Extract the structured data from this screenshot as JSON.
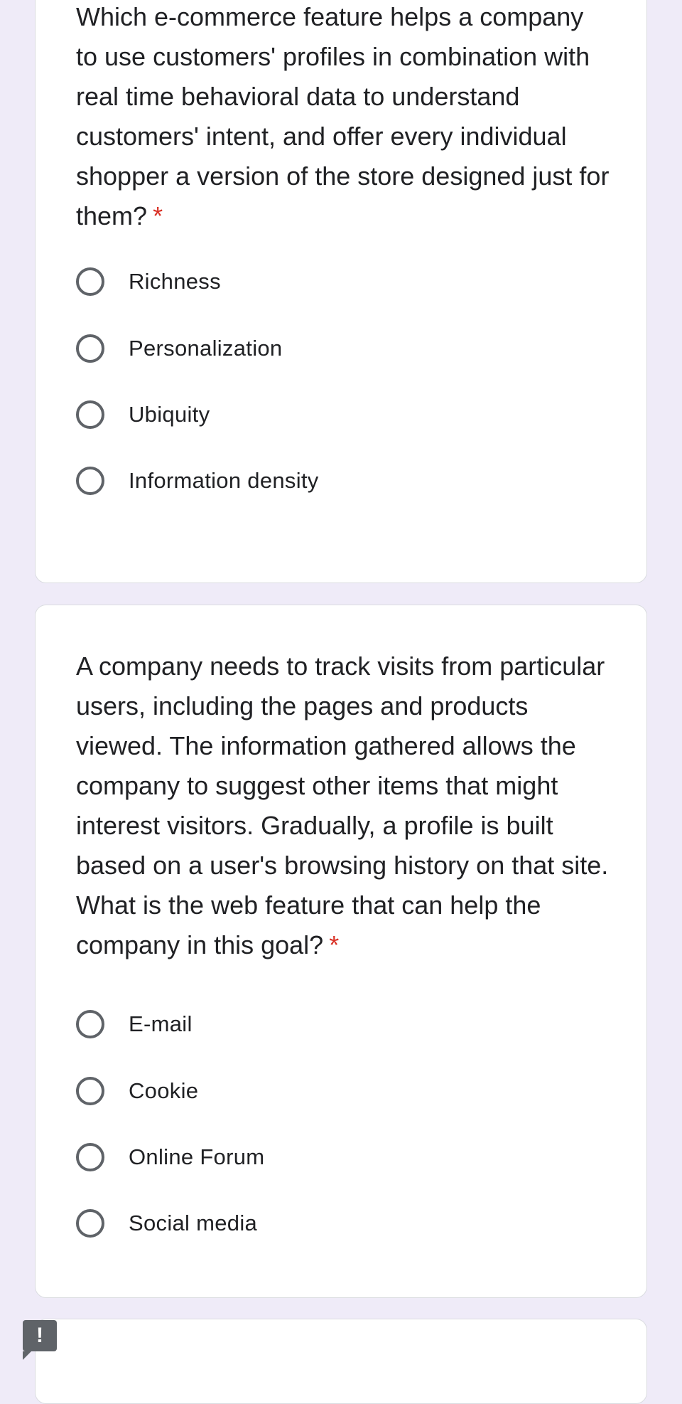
{
  "questions": [
    {
      "text": "Which e-commerce feature helps a company to use customers' profiles in combination with real time behavioral data to understand customers' intent, and offer every individual shopper a version of the store designed just for them?",
      "required_marker": "*",
      "options": [
        "Richness",
        "Personalization",
        "Ubiquity",
        "Information density"
      ]
    },
    {
      "text": "A company needs to track visits from particular users, including the pages and products viewed. The information gathered allows the company to suggest other items that might interest visitors. Gradually, a profile is built based on a user's browsing history on that site. What is the web feature that can help the company in this goal?",
      "required_marker": "*",
      "options": [
        "E-mail",
        "Cookie",
        "Online Forum",
        "Social media"
      ]
    }
  ],
  "feedback": {
    "icon": "report-issue-icon",
    "symbol": "!"
  },
  "colors": {
    "page_background": "#efebf8",
    "card_background": "#ffffff",
    "required_asterisk": "#d93025",
    "radio_border": "#5f6368"
  }
}
